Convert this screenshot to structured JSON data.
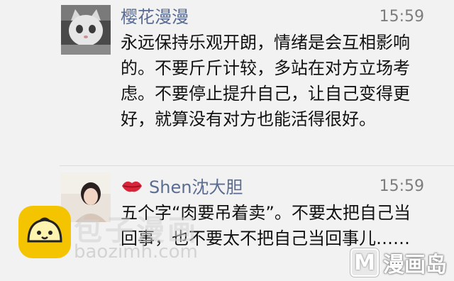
{
  "messages": [
    {
      "sender": "樱花漫漫",
      "time": "15:59",
      "avatar_icon": "cat-photo-avatar",
      "text": "永远保持乐观开朗，情绪是会互相影响的。不要斤斤计较，多站在对方立场考虑。不要停止提升自己，让自己变得更好，就算没有对方也能活得很好。"
    },
    {
      "sender": "Shen沈大胆",
      "time": "15:59",
      "avatar_icon": "woman-photo-avatar",
      "name_prefix_icon": "lips-icon",
      "text": "五个字“肉要吊着卖”。不要太把自己当回事，也不要太不把自己当回事儿……"
    }
  ],
  "watermarks": {
    "logo_text": "包子漫画",
    "url": "baozimh.com",
    "corner_letter": "M",
    "corner_text": "漫画岛"
  },
  "colors": {
    "sender_name": "#5b6c92",
    "time": "#7d7d7d",
    "background": "#f2f2f2",
    "bun_yellow": "#f5c400",
    "lips_red": "#d8253a"
  }
}
